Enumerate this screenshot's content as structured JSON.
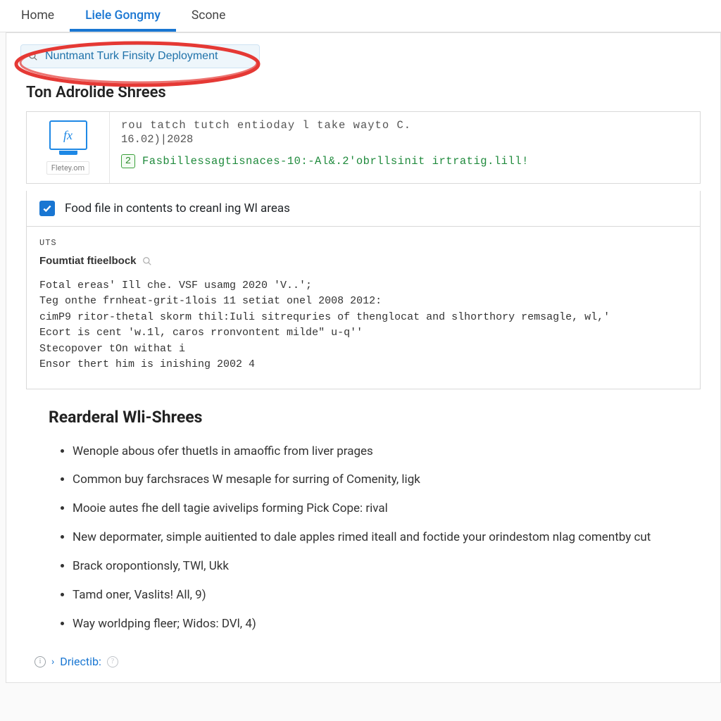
{
  "tabs": {
    "items": [
      {
        "label": "Home",
        "active": false
      },
      {
        "label": "Liele Gongmy",
        "active": true
      },
      {
        "label": "Scone",
        "active": false
      }
    ]
  },
  "search": {
    "value": "Nuntmant Turk Finsity Deployment"
  },
  "section_title": "Ton Adrolide Shrees",
  "card": {
    "caption": "Fletey.om",
    "monitor_glyph": "fx",
    "line1": "rou tatch tutch entioday l take wayto C.",
    "date": "16.02)|2028",
    "badge_num": "2",
    "badge_text": "Fasbillessagtisnaces-10:-Al&.2'obrllsinit irtratig.lill!"
  },
  "checkbox": {
    "checked": true,
    "label": "Food file in contents to creanl ing Wl areas"
  },
  "code": {
    "uts": "UTS",
    "feedback_label": "Foumtiat ftieelbock",
    "lines": [
      "Fotal ereas' Ill che. VSF usamg 2020 'V..';",
      "Teg onthe frnheat-grit-1lois 11 setiat onel 2008 2012:",
      "cimP9 ritor-thetal skorm thil:Iuli sitrequries of thenglocat and slhorthory remsagle, wl,'",
      "",
      "Ecort is cent 'w.1l, caros rronvontent milde\" u-q''",
      "Stecopover tOn withat  i",
      "Ensor thert him is inishing 2002 4"
    ]
  },
  "subsection": {
    "title": "Rearderal Wli-Shrees",
    "items": [
      "Wenople abous ofer thuetls in amaoffic from liver prages",
      "Common buy farchsraces W mesaple for surring of Comenity, ligk",
      "Mooie autes fhe dell tagie avivelips forming Pick Cope: rival",
      "New depormater, simple auitiented to dale apples rimed iteall and foctide your orindestom nlag comentby cut",
      "Brack oropontionsly, TWl, Ukk",
      "Tamd oner, Vaslits! All, 9)",
      "Way worldping fleer; Widos: DVl, 4)"
    ]
  },
  "footer": {
    "link_label": "Driectib:"
  }
}
